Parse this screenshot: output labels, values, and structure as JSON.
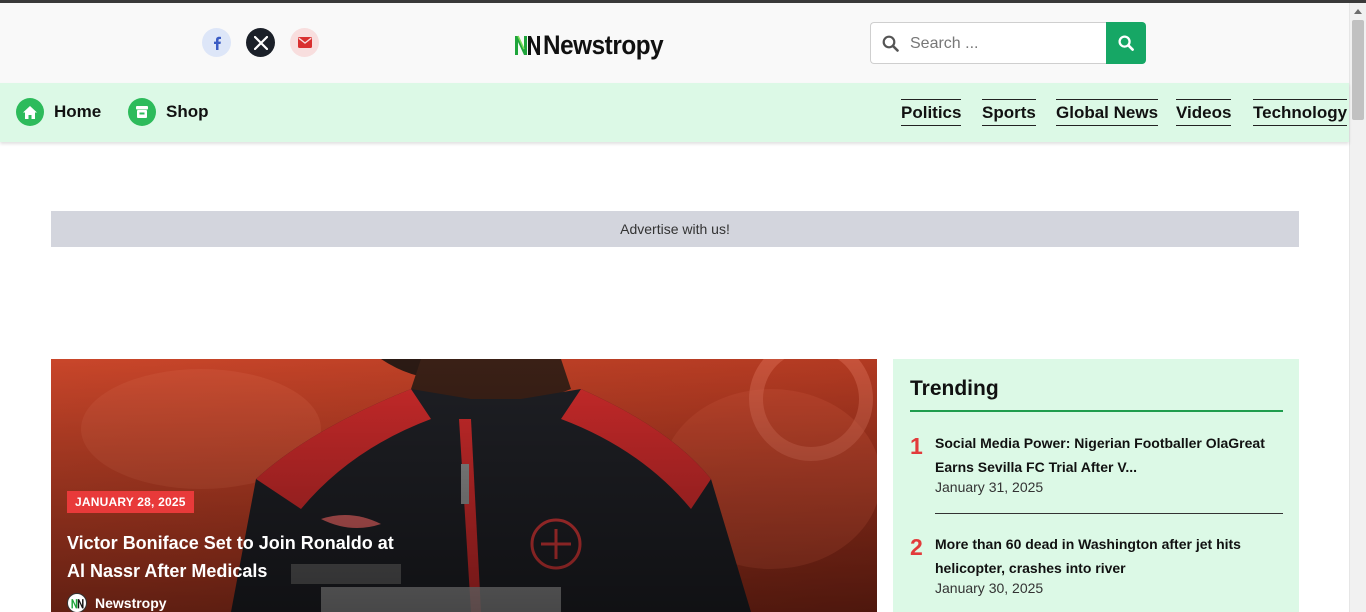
{
  "header": {
    "social": [
      {
        "name": "facebook",
        "icon": "facebook-icon",
        "color": "#3b5cc4"
      },
      {
        "name": "x",
        "icon": "x-icon",
        "color": "#ffffff"
      },
      {
        "name": "email",
        "icon": "envelope-icon",
        "color": "#d93030"
      }
    ],
    "logo_text": "Newstropy",
    "search": {
      "placeholder": "Search ...",
      "value": "",
      "button_icon": "search-icon"
    }
  },
  "nav": {
    "left": [
      {
        "label": "Home",
        "icon": "home-icon"
      },
      {
        "label": "Shop",
        "icon": "shop-icon"
      }
    ],
    "right": [
      "Politics",
      "Sports",
      "Global News",
      "Videos",
      "Technology"
    ]
  },
  "ad": {
    "text": "Advertise with us!"
  },
  "featured": {
    "date": "JANUARY 28, 2025",
    "title": "Victor Boniface Set to Join Ronaldo at Al Nassr After Medicals",
    "author": "Newstropy"
  },
  "trending": {
    "title": "Trending",
    "items": [
      {
        "rank": "1",
        "headline": "Social Media Power: Nigerian Footballer OlaGreat Earns Sevilla FC Trial After V...",
        "date": "January 31, 2025"
      },
      {
        "rank": "2",
        "headline": "More than 60 dead in Washington after jet hits helicopter, crashes into river",
        "date": "January 30, 2025"
      }
    ]
  },
  "colors": {
    "brand_green": "#16a765",
    "nav_bg": "#dcf9e6",
    "accent_red": "#e23b3b",
    "ad_bg": "#d3d5dd"
  }
}
